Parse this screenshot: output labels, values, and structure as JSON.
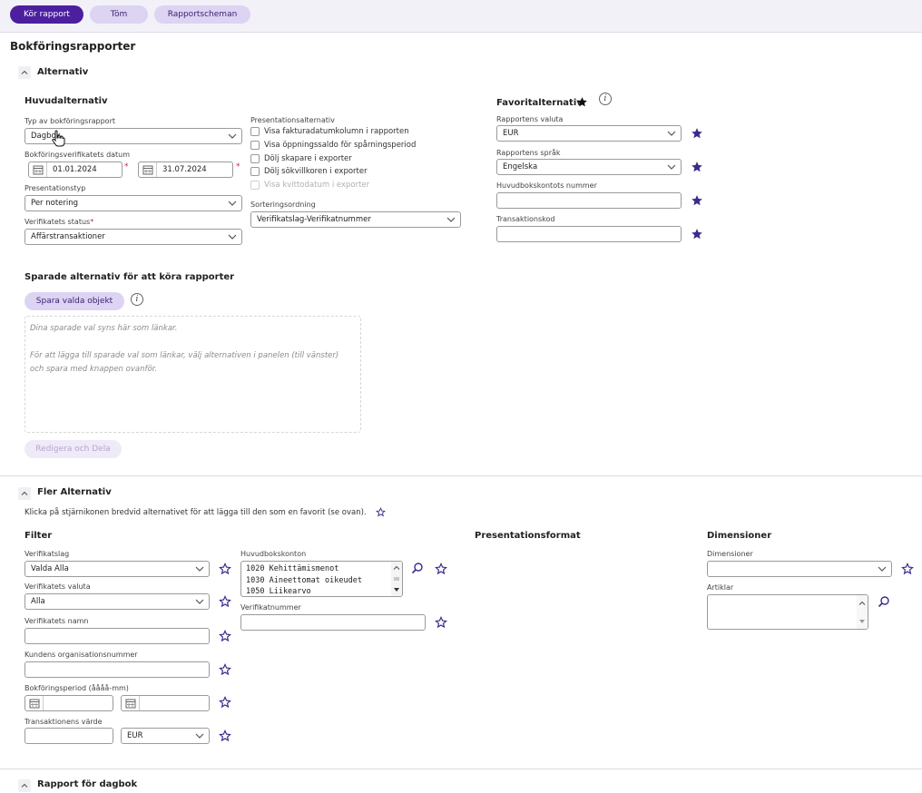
{
  "toolbar": {
    "run": "Kör rapport",
    "clear": "Töm",
    "schedules": "Rapportscheman"
  },
  "page": {
    "title": "Bokföringsrapporter"
  },
  "alternativ": {
    "section_title": "Alternativ",
    "main": {
      "heading": "Huvudalternativ",
      "report_type_label": "Typ av bokföringsrapport",
      "report_type_value": "Dagbok",
      "date_label": "Bokföringsverifikatets datum",
      "date_from": "01.01.2024",
      "date_to": "31.07.2024",
      "presentation_type_label": "Presentationstyp",
      "presentation_type_value": "Per notering",
      "voucher_status_label": "Verifikatets status",
      "voucher_status_value": "Affärstransaktioner",
      "required_mark": "*"
    },
    "presentation": {
      "label": "Presentationsalternativ",
      "options": [
        "Visa fakturadatumkolumn i rapporten",
        "Visa öppningssaldo för spårningsperiod",
        "Dölj skapare i exporter",
        "Dölj sökvillkoren i exporter",
        "Visa kvittodatum i exporter"
      ],
      "sort_label": "Sorteringsordning",
      "sort_value": "Verifikatslag-Verifikatnummer"
    },
    "favorites": {
      "heading": "Favoritalternativ",
      "currency_label": "Rapportens valuta",
      "currency_value": "EUR",
      "language_label": "Rapportens språk",
      "language_value": "Engelska",
      "account_label": "Huvudbokskontots nummer",
      "account_value": "",
      "transcode_label": "Transaktionskod",
      "transcode_value": ""
    },
    "saved": {
      "heading": "Sparade alternativ för att köra rapporter",
      "save_button": "Spara valda objekt",
      "hint_line1": "Dina sparade val syns här som länkar.",
      "hint_line2": "För att lägga till sparade val som länkar, välj alternativen i panelen (till vänster)",
      "hint_line3": "och spara med knappen ovanför.",
      "edit_share": "Redigera och Dela"
    }
  },
  "fler": {
    "section_title": "Fler Alternativ",
    "note": "Klicka på stjärnikonen bredvid alternativet för att lägga till den som en favorit (se ovan).",
    "filter": {
      "heading": "Filter",
      "voucher_type_label": "Verifikatslag",
      "voucher_type_value": "Valda Alla",
      "voucher_currency_label": "Verifikatets valuta",
      "voucher_currency_value": "Alla",
      "voucher_name_label": "Verifikatets namn",
      "customer_org_label": "Kundens organisationsnummer",
      "period_label": "Bokföringsperiod (åååå-mm)",
      "trans_value_label": "Transaktionens värde",
      "trans_value_currency": "EUR"
    },
    "accounts": {
      "label": "Huvudbokskonton",
      "items": [
        "1020 Kehittämismenot",
        "1030 Aineettomat oikeudet",
        "1050 Liikearvo"
      ],
      "voucher_number_label": "Verifikatnummer"
    },
    "presentation_format": {
      "heading": "Presentationsformat"
    },
    "dimensions": {
      "heading": "Dimensioner",
      "dim_label": "Dimensioner",
      "dim_value": "",
      "articles_label": "Artiklar"
    }
  },
  "journal": {
    "section_title": "Rapport för dagbok"
  },
  "colors": {
    "primary": "#4b1fa0",
    "secondary": "#ddd3f3",
    "star": "#3b2a8c"
  }
}
